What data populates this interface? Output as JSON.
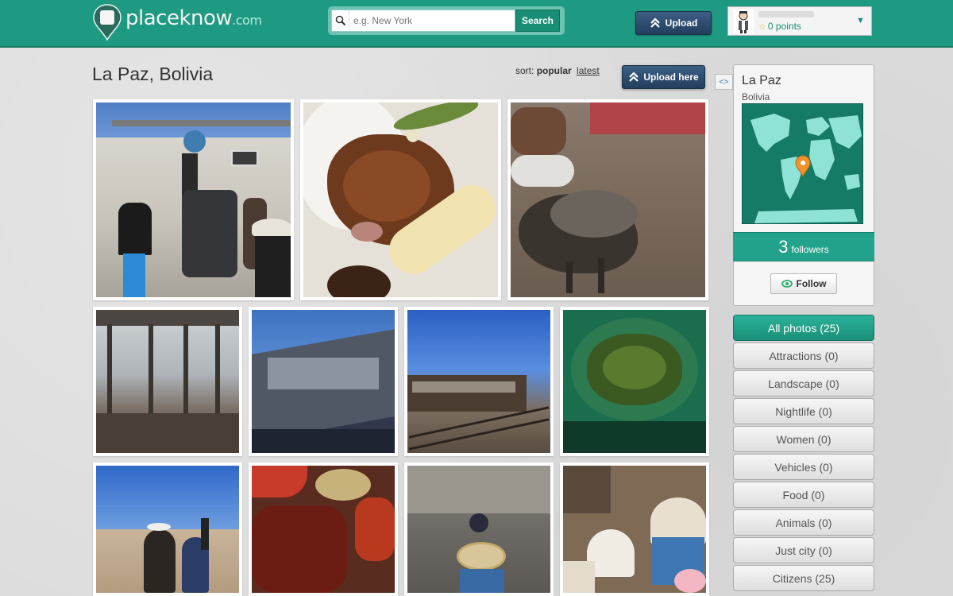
{
  "header": {
    "logo_text": "placeknow",
    "logo_domain": ".com",
    "search_placeholder": "e.g. New York",
    "search_button": "Search",
    "upload_button": "Upload",
    "user_points": "0 points"
  },
  "main": {
    "title": "La Paz, Bolivia",
    "sort_prefix": "sort:",
    "sort_popular": "popular",
    "sort_latest": "latest",
    "upload_here": "Upload here",
    "collapse_icon": "<>"
  },
  "photos": [
    {
      "subject": "people-at-station-building"
    },
    {
      "subject": "plate-of-food"
    },
    {
      "subject": "dog-on-sand"
    },
    {
      "subject": "train-car-interior"
    },
    {
      "subject": "abandoned-train-car"
    },
    {
      "subject": "train-on-tracks"
    },
    {
      "subject": "coca-leaves-in-sack"
    },
    {
      "subject": "women-in-desert"
    },
    {
      "subject": "dried-chili-peppers"
    },
    {
      "subject": "child-selling-bread"
    },
    {
      "subject": "market-sacks-of-grain"
    }
  ],
  "sidebar": {
    "place_name": "La Paz",
    "country": "Bolivia",
    "followers_count": "3",
    "followers_label": "followers",
    "follow_button": "Follow",
    "categories": [
      {
        "label": "All photos (25)",
        "active": true
      },
      {
        "label": "Attractions (0)",
        "active": false
      },
      {
        "label": "Landscape (0)",
        "active": false
      },
      {
        "label": "Nightlife (0)",
        "active": false
      },
      {
        "label": "Women (0)",
        "active": false
      },
      {
        "label": "Vehicles (0)",
        "active": false
      },
      {
        "label": "Food (0)",
        "active": false
      },
      {
        "label": "Animals (0)",
        "active": false
      },
      {
        "label": "Just city (0)",
        "active": false
      },
      {
        "label": "Citizens (25)",
        "active": false
      }
    ]
  },
  "colors": {
    "brand": "#1f9a82",
    "upload_button": "#2d4d70",
    "active_category": "#22a28a"
  }
}
